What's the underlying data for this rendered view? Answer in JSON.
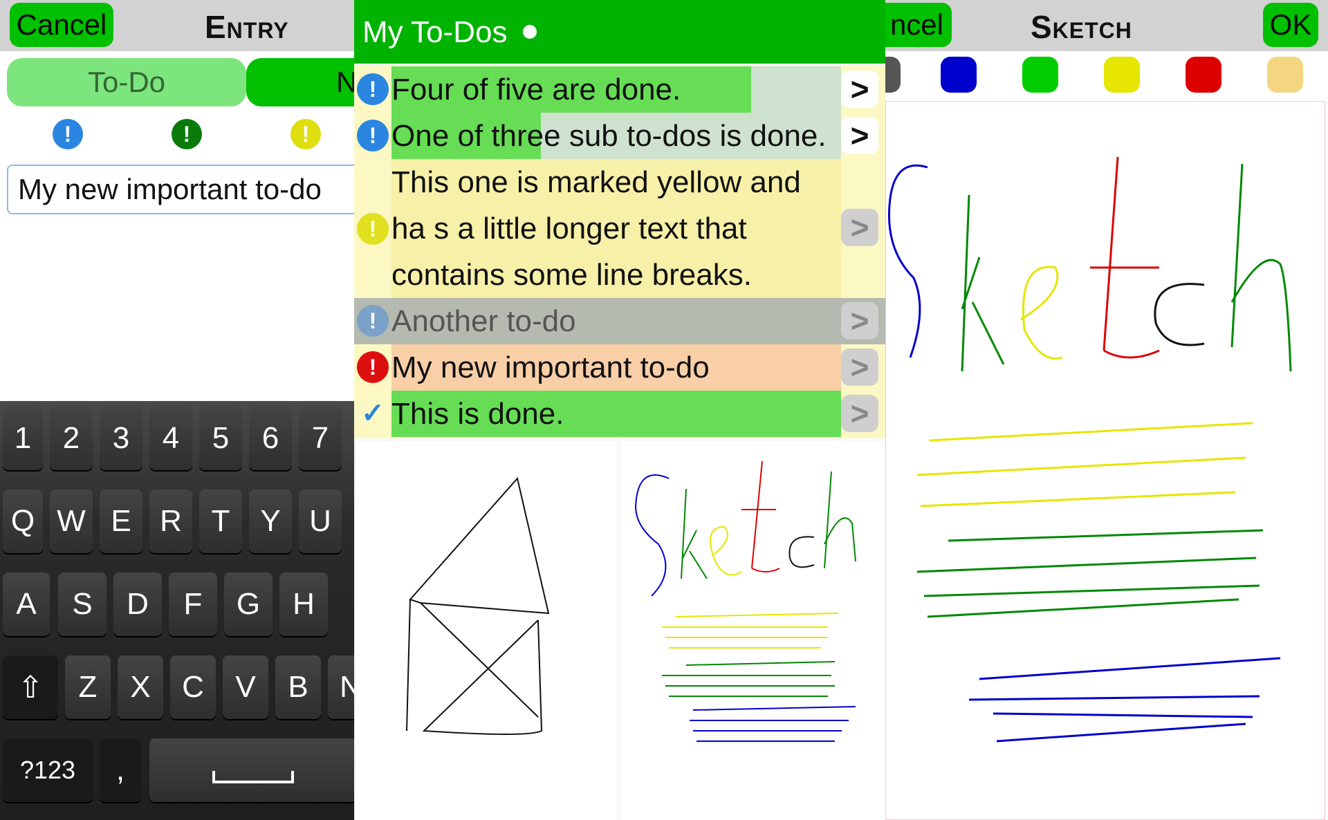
{
  "entry_panel": {
    "cancel_label": "Cancel",
    "title": "Entry",
    "segments": {
      "todo": "To-Do",
      "note_partial": "N"
    },
    "input_value": "My new important to-do",
    "priority_icons": [
      "blue-exclamation-icon",
      "green-exclamation-icon",
      "yellow-exclamation-icon"
    ],
    "keyboard": {
      "row1": [
        "1",
        "2",
        "3",
        "4",
        "5",
        "6",
        "7"
      ],
      "row2": [
        "Q",
        "W",
        "E",
        "R",
        "T",
        "Y",
        "U"
      ],
      "row3": [
        "A",
        "S",
        "D",
        "F",
        "G",
        "H"
      ],
      "row4": [
        "Z",
        "X",
        "C",
        "V",
        "B",
        "N"
      ],
      "mode_key": "?123",
      "comma_key": ","
    }
  },
  "list_panel": {
    "title": "My To-Dos",
    "items": [
      {
        "text": "Four of five are done.",
        "status": "blue",
        "progress": 0.8
      },
      {
        "text": "One of three sub to-dos is done.",
        "status": "blue",
        "progress": 0.33
      },
      {
        "text": "This one is marked yellow and ha s a little longer text that contains some line breaks.",
        "status": "yellow"
      },
      {
        "text": "Another to-do",
        "status": "grey"
      },
      {
        "text": "My new important to-do",
        "status": "red"
      },
      {
        "text": "This is done.",
        "status": "done"
      }
    ]
  },
  "sketch_panel": {
    "cancel_partial": "ncel",
    "title": "Sketch",
    "ok_label": "OK",
    "colors": [
      "#0000cc",
      "#00cc00",
      "#e6e600",
      "#dd0000"
    ],
    "tools": [
      "pen-black-icon",
      "pen-blue-icon",
      "pen-green-icon",
      "pen-yellow-icon",
      "pen-red-icon",
      "eraser-icon"
    ]
  }
}
